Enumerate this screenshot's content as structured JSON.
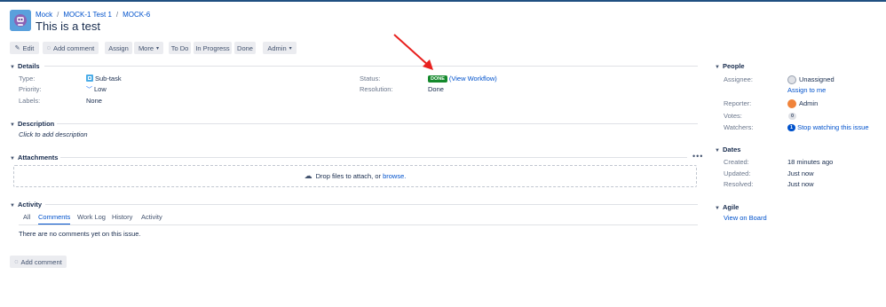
{
  "breadcrumb": {
    "project": "Mock",
    "parent": "MOCK-1 Test 1",
    "issue": "MOCK-6"
  },
  "issue": {
    "title": "This is a test"
  },
  "toolbar": {
    "edit": "Edit",
    "add_comment": "Add comment",
    "assign": "Assign",
    "more": "More",
    "to_do": "To Do",
    "in_progress": "In Progress",
    "done": "Done",
    "admin": "Admin"
  },
  "details": {
    "heading": "Details",
    "type_label": "Type:",
    "type_value": "Sub-task",
    "priority_label": "Priority:",
    "priority_value": "Low",
    "labels_label": "Labels:",
    "labels_value": "None",
    "status_label": "Status:",
    "status_value": "DONE",
    "view_workflow": "(View Workflow)",
    "resolution_label": "Resolution:",
    "resolution_value": "Done"
  },
  "description": {
    "heading": "Description",
    "placeholder": "Click to add description"
  },
  "attachments": {
    "heading": "Attachments",
    "drop_text": "Drop files to attach, or",
    "browse": "browse."
  },
  "activity": {
    "heading": "Activity",
    "tabs": [
      "All",
      "Comments",
      "Work Log",
      "History",
      "Activity"
    ],
    "active_tab": "Comments",
    "empty": "There are no comments yet on this issue.",
    "add_comment": "Add comment"
  },
  "people": {
    "heading": "People",
    "assignee_label": "Assignee:",
    "assignee_value": "Unassigned",
    "assign_to_me": "Assign to me",
    "reporter_label": "Reporter:",
    "reporter_value": "Admin",
    "votes_label": "Votes:",
    "votes_value": "0",
    "watchers_label": "Watchers:",
    "watchers_count": "1",
    "watchers_link": "Stop watching this issue"
  },
  "dates": {
    "heading": "Dates",
    "created_label": "Created:",
    "created_value": "18 minutes ago",
    "updated_label": "Updated:",
    "updated_value": "Just now",
    "resolved_label": "Resolved:",
    "resolved_value": "Just now"
  },
  "agile": {
    "heading": "Agile",
    "view_on_board": "View on Board"
  },
  "colors": {
    "status_done": "#14892c",
    "link": "#0052cc",
    "annotation_arrow": "#e8201e"
  }
}
